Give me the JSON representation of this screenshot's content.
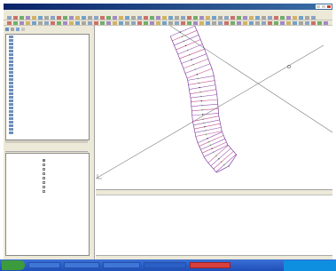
{
  "app": {
    "title": "",
    "accent": "#0a246a",
    "close_color": "#c8412f"
  },
  "menu": {
    "items": [
      "",
      "",
      "",
      "",
      "",
      "",
      "",
      "",
      "",
      "",
      ""
    ]
  },
  "toolbar": {
    "icons": [
      "toolbar-icon",
      "toolbar-icon",
      "toolbar-icon",
      "toolbar-icon",
      "toolbar-icon",
      "toolbar-icon",
      "toolbar-icon",
      "toolbar-icon"
    ]
  },
  "tree": {
    "items": [
      "",
      "",
      "",
      "",
      "",
      "",
      "",
      "",
      "",
      "",
      "",
      "",
      "",
      "",
      "",
      "",
      "",
      "",
      "",
      "",
      "",
      "",
      "",
      "",
      "",
      "",
      "",
      ""
    ]
  },
  "properties": {
    "rows": [
      {
        "name": "",
        "value": "",
        "checked": true
      },
      {
        "name": "",
        "value": "",
        "checked": false
      },
      {
        "name": "",
        "value": "",
        "checked": false
      },
      {
        "name": "",
        "value": "",
        "checked": false
      },
      {
        "name": "",
        "value": "",
        "checked": false
      },
      {
        "name": "",
        "value": "",
        "checked": false
      },
      {
        "name": "",
        "value": "",
        "checked": false
      },
      {
        "name": "",
        "value": "",
        "checked": false
      }
    ]
  },
  "command": {
    "lines": [
      "",
      "",
      "",
      "",
      "",
      "",
      ""
    ]
  },
  "taskbar": {
    "start_label": "",
    "tray_accent": "#0f8fe0",
    "items": [
      "",
      "",
      "",
      "",
      ""
    ]
  }
}
